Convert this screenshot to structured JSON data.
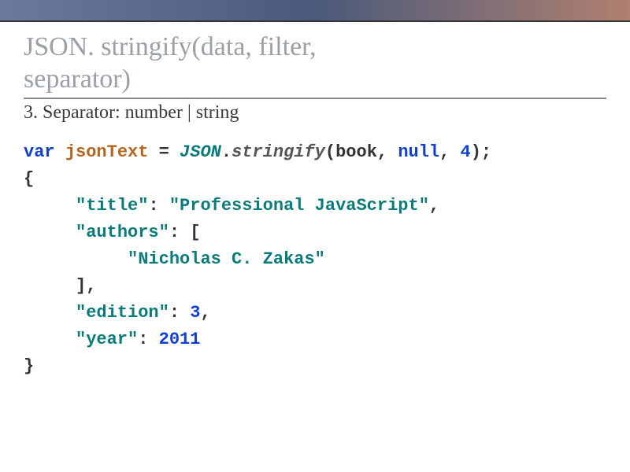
{
  "title_line1": "JSON. stringify(data, filter,",
  "title_line2": "separator)",
  "subtitle": "3. Separator: number | string",
  "code": {
    "kw_var": "var",
    "var_name": "jsonText",
    "eq": " = ",
    "cls": "JSON",
    "dot": ".",
    "method": "stringify",
    "open": "(",
    "arg1": "book",
    "comma1": ", ",
    "arg2": "null",
    "comma2": ", ",
    "arg3": "4",
    "close": ");",
    "lbrace": "{",
    "indent1": "     ",
    "indent2": "          ",
    "key_title": "\"title\"",
    "colon": ": ",
    "val_title": "\"Professional JavaScript\"",
    "comma": ",",
    "key_authors": "\"authors\"",
    "bracket_open": "[",
    "author0": "\"Nicholas C. Zakas\"",
    "bracket_close": "]",
    "key_edition": "\"edition\"",
    "val_edition": "3",
    "key_year": "\"year\"",
    "val_year": "2011",
    "rbrace": "}"
  }
}
